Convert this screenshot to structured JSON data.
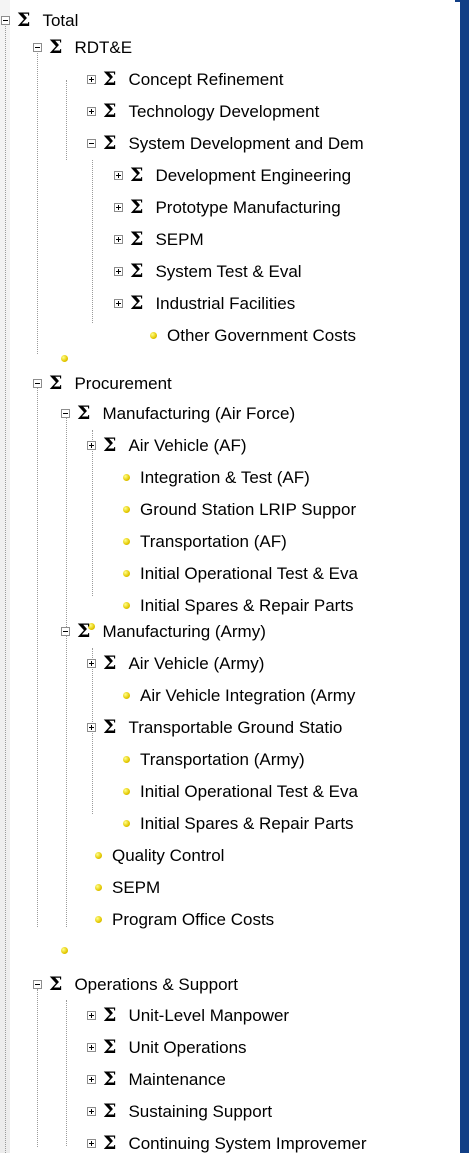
{
  "tree": {
    "total": "Total",
    "rdte": {
      "label": "RDT&E",
      "children": [
        "Concept Refinement",
        "Technology Development",
        "System Development and Dem"
      ],
      "sdd_children": [
        "Development Engineering",
        "Prototype Manufacturing",
        "SEPM",
        "System Test & Eval",
        "Industrial Facilities",
        "Other Government Costs"
      ]
    },
    "procurement": {
      "label": "Procurement",
      "mfg_af": {
        "label": "Manufacturing (Air Force)",
        "children": [
          "Air Vehicle (AF)",
          "Integration & Test (AF)",
          "Ground Station LRIP Suppor",
          "Transportation (AF)",
          "Initial Operational Test & Eva",
          "Initial Spares & Repair Parts"
        ]
      },
      "mfg_army": {
        "label": "Manufacturing (Army)",
        "children": [
          "Air Vehicle (Army)",
          "Air Vehicle Integration (Army",
          "Transportable Ground Statio",
          "Transportation (Army)",
          "Initial Operational Test & Eva",
          "Initial Spares & Repair Parts"
        ]
      },
      "other": [
        "Quality Control",
        "SEPM",
        "Program Office Costs"
      ]
    },
    "ops": {
      "label": "Operations & Support",
      "children": [
        "Unit-Level Manpower",
        "Unit Operations",
        "Maintenance",
        "Sustaining Support",
        "Continuing System Improvemer"
      ]
    }
  },
  "colors": {
    "frame": "#123f86",
    "connector": "#9b9b9b",
    "leaf_dot": "#e4c800"
  },
  "icons": {
    "sum": "sigma-icon",
    "leaf": "leaf-dot-icon",
    "expanded": "minus-box-icon",
    "collapsed": "plus-box-icon"
  }
}
